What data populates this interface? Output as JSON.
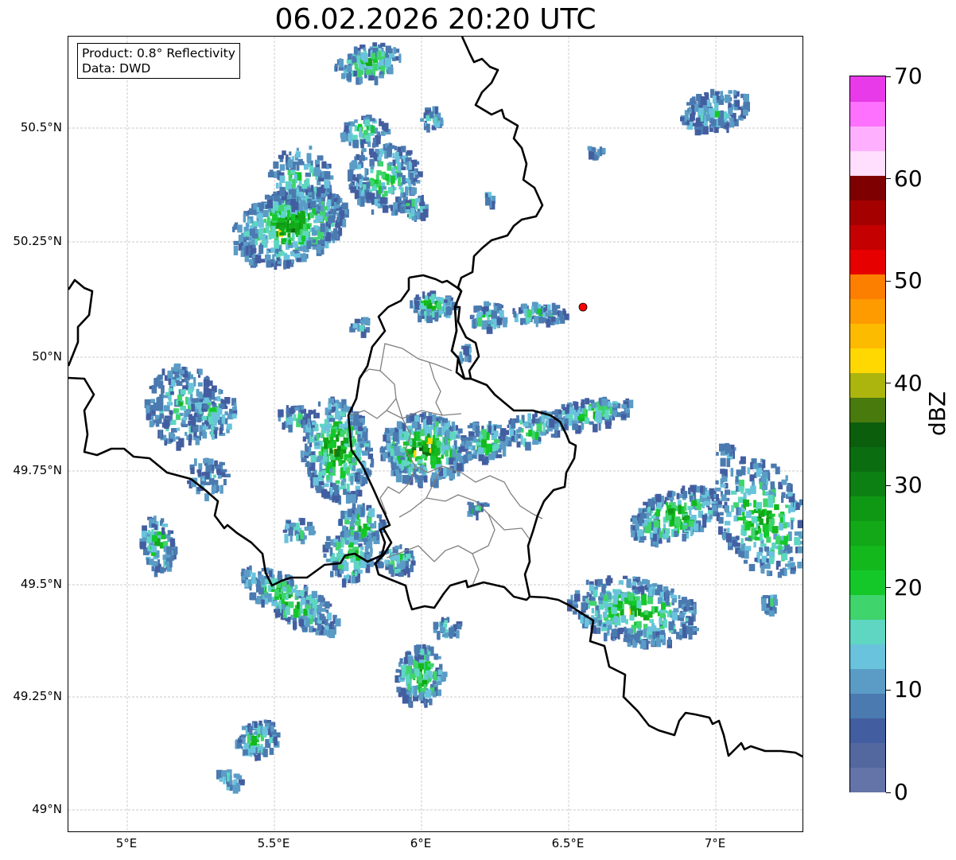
{
  "title": "06.02.2026 20:20 UTC",
  "info": {
    "product": "Product: 0.8° Reflectivity",
    "data": "Data: DWD"
  },
  "axes": {
    "lon_ticks": [
      "5°E",
      "5.5°E",
      "6°E",
      "6.5°E",
      "7°E"
    ],
    "lat_ticks": [
      "50.5°N",
      "50.25°N",
      "50°N",
      "49.75°N",
      "49.5°N",
      "49.25°N",
      "49°N"
    ],
    "lon_range": [
      4.8,
      7.3
    ],
    "lat_range": [
      48.95,
      50.7
    ],
    "grid": true
  },
  "radar_site": {
    "lon": 6.55,
    "lat": 50.11,
    "color": "#ff0000"
  },
  "colorbar": {
    "label": "dBZ",
    "tick_labels": [
      "0",
      "10",
      "20",
      "30",
      "40",
      "50",
      "60",
      "70"
    ],
    "range": [
      0,
      70
    ],
    "step": 2.5,
    "colors": [
      "#6474a8",
      "#52689e",
      "#435ea0",
      "#4a7ab0",
      "#5a9cc6",
      "#69c3dc",
      "#5ed6c2",
      "#3fd46c",
      "#14c82a",
      "#13b81c",
      "#12a818",
      "#0f9814",
      "#0c8012",
      "#0a6e10",
      "#0b5e0c",
      "#487a0e",
      "#acb40e",
      "#fed800",
      "#fdbb00",
      "#fd9b00",
      "#fd7f00",
      "#e60000",
      "#c40000",
      "#a40000",
      "#7f0000",
      "#ffdefe",
      "#feb0fe",
      "#fe70fe",
      "#e83ae8"
    ]
  }
}
